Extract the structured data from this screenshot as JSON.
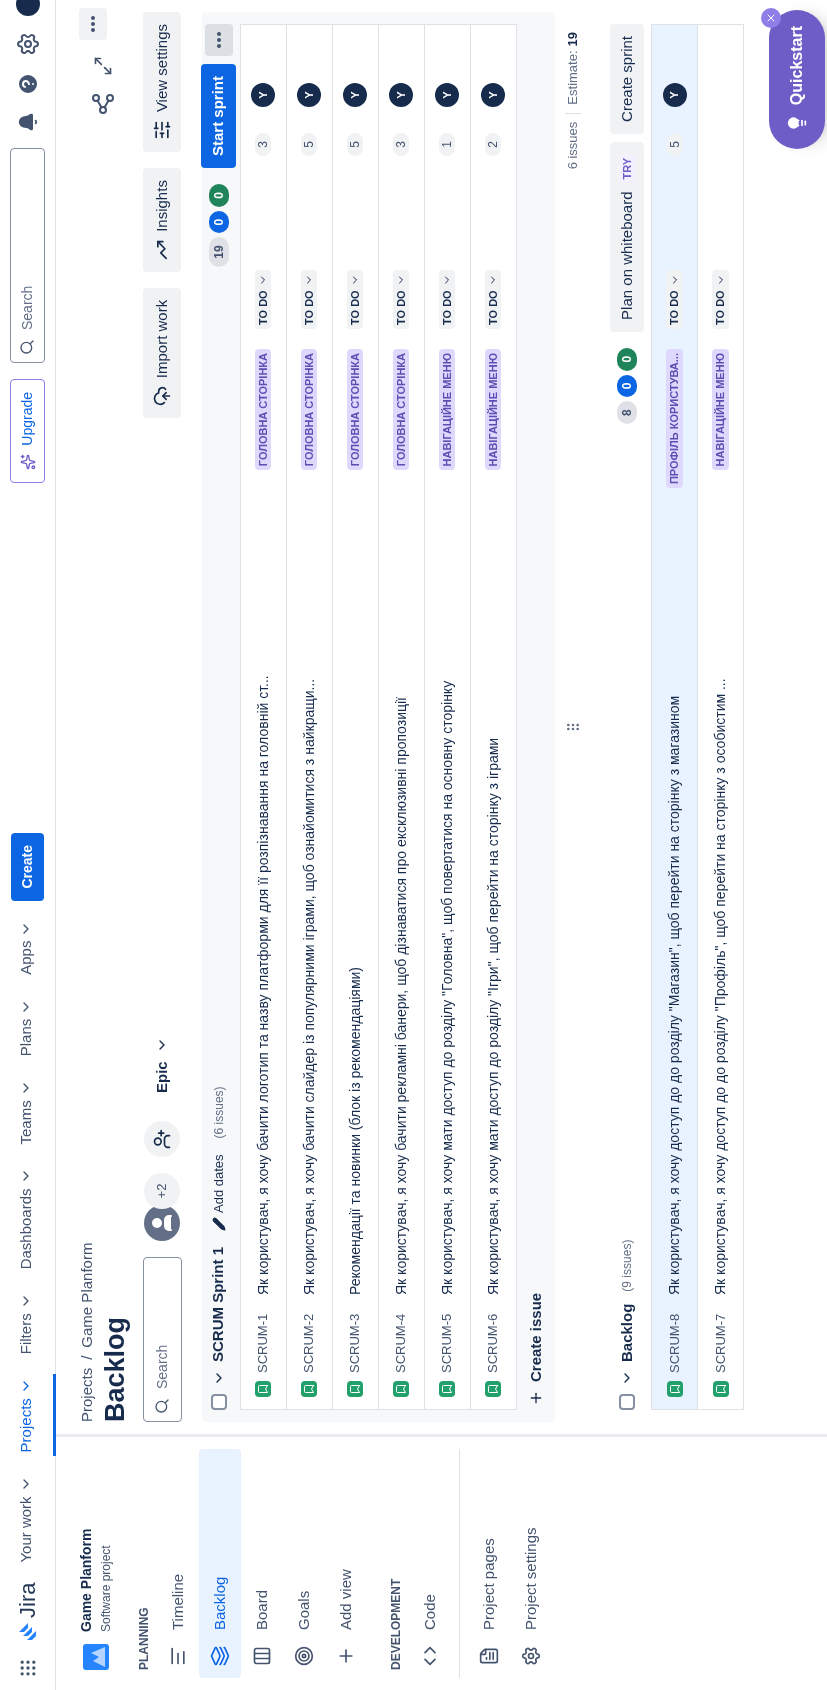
{
  "header": {
    "logo": "Jira",
    "nav": [
      {
        "label": "Your work",
        "selected": false
      },
      {
        "label": "Projects",
        "selected": true
      },
      {
        "label": "Filters",
        "selected": false
      },
      {
        "label": "Dashboards",
        "selected": false
      },
      {
        "label": "Teams",
        "selected": false
      },
      {
        "label": "Plans",
        "selected": false
      },
      {
        "label": "Apps",
        "selected": false
      }
    ],
    "create": "Create",
    "upgrade": "Upgrade",
    "search_placeholder": "Search"
  },
  "sidebar": {
    "project": {
      "name": "Game Planform",
      "type": "Software project"
    },
    "groups": [
      {
        "heading": "PLANNING",
        "items": [
          {
            "label": "Timeline",
            "selected": false
          },
          {
            "label": "Backlog",
            "selected": true
          },
          {
            "label": "Board",
            "selected": false
          },
          {
            "label": "Goals",
            "selected": false
          },
          {
            "label": "Add view",
            "selected": false
          }
        ]
      },
      {
        "heading": "DEVELOPMENT",
        "items": [
          {
            "label": "Code",
            "selected": false
          }
        ]
      },
      {
        "items": [
          {
            "label": "Project pages",
            "selected": false
          },
          {
            "label": "Project settings",
            "selected": false
          }
        ]
      }
    ]
  },
  "page": {
    "breadcrumb": [
      "Projects",
      "Game Planform"
    ],
    "breadcrumb_separator": "/",
    "title": "Backlog",
    "search_placeholder": "Search",
    "avatar_more": "+2",
    "filter": "Epic",
    "actions": [
      "Import work",
      "Insights",
      "View settings"
    ]
  },
  "sprint": {
    "name": "SCRUM Sprint 1",
    "add_dates": "Add dates",
    "issue_count": "(6 issues)",
    "checked": false,
    "counts": [
      {
        "kind": "todo",
        "value": "19"
      },
      {
        "kind": "progress",
        "value": "0"
      },
      {
        "kind": "done",
        "value": "0"
      }
    ],
    "start": "Start sprint",
    "issues": [
      {
        "key": "SCRUM-1",
        "summary": "Як користувач, я хочу бачити логотип та назву платформи для її розпізнавання на головній ст...",
        "epic": "ГОЛОВНА СТОРІНКА",
        "status": "TO DO",
        "estimate": "3",
        "assignee": "Y",
        "selected": false
      },
      {
        "key": "SCRUM-2",
        "summary": "Як користувач, я хочу бачити слайдер із популярними іграми, щоб ознайомитися з найкращи...",
        "epic": "ГОЛОВНА СТОРІНКА",
        "status": "TO DO",
        "estimate": "5",
        "assignee": "Y",
        "selected": false
      },
      {
        "key": "SCRUM-3",
        "summary": "Рекомендації та новинки (блок із рекомендаціями)",
        "epic": "ГОЛОВНА СТОРІНКА",
        "status": "TO DO",
        "estimate": "5",
        "assignee": "Y",
        "selected": false
      },
      {
        "key": "SCRUM-4",
        "summary": "Як користувач, я хочу бачити рекламні банери, щоб дізнаватися про ексклюзивні пропозиції",
        "epic": "ГОЛОВНА СТОРІНКА",
        "status": "TO DO",
        "estimate": "3",
        "assignee": "Y",
        "selected": false
      },
      {
        "key": "SCRUM-5",
        "summary": "Як користувач, я хочу мати доступ до розділу \"Головна\", щоб повертатися на основну сторінку",
        "epic": "НАВІГАЦІЙНЕ МЕНЮ",
        "status": "TO DO",
        "estimate": "1",
        "assignee": "Y",
        "selected": false
      },
      {
        "key": "SCRUM-6",
        "summary": "Як користувач, я хочу мати доступ до розділу \"Ігри\", щоб перейти на сторінку з іграми",
        "epic": "НАВІГАЦІЙНЕ МЕНЮ",
        "status": "TO DO",
        "estimate": "2",
        "assignee": "Y",
        "selected": false
      }
    ],
    "create_issue": "Create issue",
    "summary_issues": "6 issues",
    "estimate_label": "Estimate:",
    "estimate": "19"
  },
  "backlog": {
    "name": "Backlog",
    "issue_count": "(9 issues)",
    "checked": false,
    "counts": [
      {
        "kind": "todo",
        "value": "8"
      },
      {
        "kind": "progress",
        "value": "0"
      },
      {
        "kind": "done",
        "value": "0"
      }
    ],
    "whiteboard": "Plan on whiteboard",
    "whiteboard_badge": "TRY",
    "create_sprint": "Create sprint",
    "issues": [
      {
        "key": "SCRUM-8",
        "summary": "Як користувач, я хочу доступ до до розділу \"Магазин\", щоб перейти на сторінку з магазином",
        "epic": "ПРОФІЛЬ КОРИСТУВА...",
        "status": "TO DO",
        "estimate": "5",
        "assignee": "Y",
        "selected": true
      },
      {
        "key": "SCRUM-7",
        "summary": "Як користувач, я хочу доступ до до розділу \"Профіль\", щоб перейти на сторінку з особистим ...",
        "epic": "НАВІГАЦІЙНЕ МЕНЮ",
        "status": "TO DO",
        "selected": false
      }
    ]
  },
  "quickstart": {
    "label": "Quickstart"
  }
}
